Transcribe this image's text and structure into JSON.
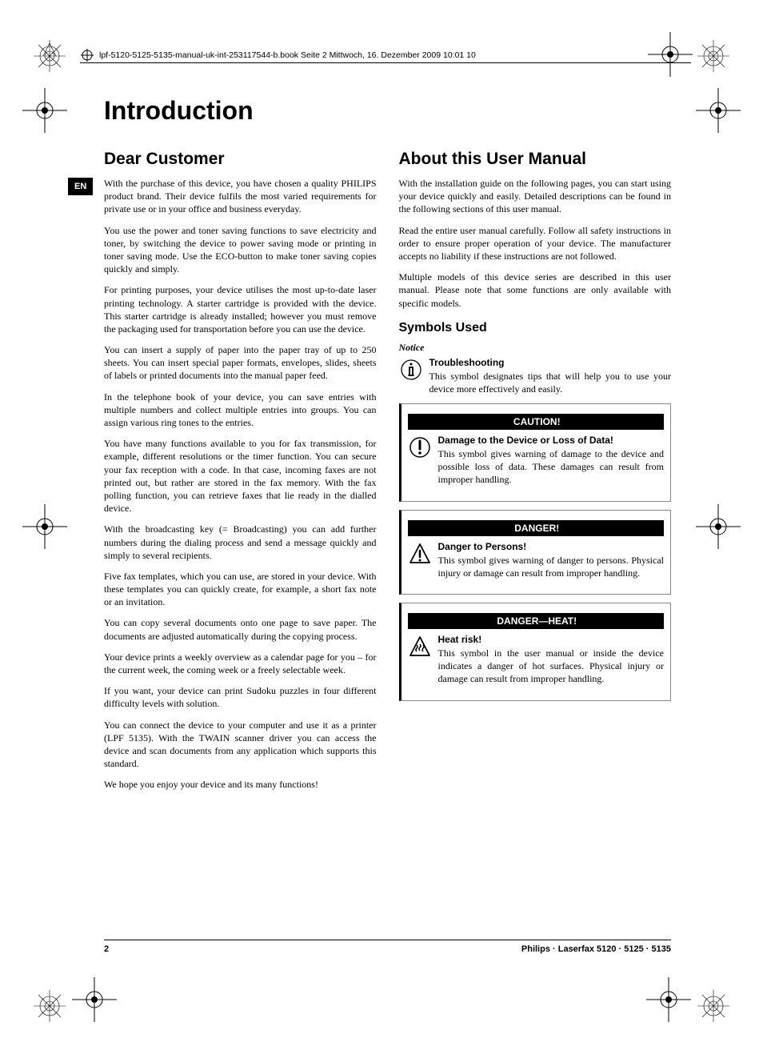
{
  "header": {
    "meta_line": "lpf-5120-5125-5135-manual-uk-int-253117544-b.book  Seite 2  Mittwoch, 16. Dezember 2009  10:01 10"
  },
  "lang_tab": "EN",
  "chapter_title": "Introduction",
  "left_column": {
    "heading": "Dear Customer",
    "paragraphs": [
      "With the purchase of this device, you have chosen a quality PHILIPS product brand. Their device fulfils the most varied requirements for private use or in your office and business everyday.",
      "You use the power and toner saving functions to save electricity and toner, by switching the device to power saving mode or printing in toner saving mode. Use the ECO-button to make toner saving copies quickly and simply.",
      "For printing purposes, your device utilises the most up-to-date laser printing technology. A starter cartridge is provided with the device. This starter cartridge is already installed; however you must remove the packaging used for transportation before you can use the device.",
      "You can insert a supply of paper into the paper tray of up to 250 sheets. You can insert special paper formats, envelopes, slides, sheets of labels or printed documents into the manual paper feed.",
      "In the telephone book of your device, you can save entries with multiple numbers and collect multiple entries into groups. You can assign various ring tones to the entries.",
      "You have many functions available to you for fax transmission, for example, different resolutions or the timer function. You can secure your fax reception with a code. In that case, incoming faxes are not printed out, but rather are stored in the fax memory. With the fax polling function, you can retrieve faxes that lie ready in the dialled device.",
      "With the broadcasting key (= Broadcasting) you can add further numbers during the dialing process and send a message quickly and simply to several recipients.",
      "Five fax templates, which you can use, are stored in your device. With these templates you can quickly create, for example, a short fax note or an invitation.",
      "You can copy several documents onto one page to save paper. The documents are adjusted automatically during the copying process.",
      "Your device prints a weekly overview as a calendar page for you – for the current week, the coming week or a freely selectable week.",
      "If you want, your device can print Sudoku puzzles in four different difficulty levels with solution.",
      "You can connect the device to your computer and use it as a printer (LPF 5135). With the TWAIN scanner driver you can access the device and scan documents from any application which supports this standard.",
      "We hope you enjoy your device and its many functions!"
    ]
  },
  "right_column": {
    "heading": "About this User Manual",
    "intro_paragraphs": [
      "With the installation guide on the following pages, you can start using your device quickly and easily. Detailed descriptions can be found in the following sections of this user manual.",
      "Read the entire user manual carefully. Follow all safety instructions in order to ensure proper operation of your device. The manufacturer accepts no liability if these instructions are not followed.",
      "Multiple models of this device series are described in this user manual. Please note that some functions are only available with specific models."
    ],
    "symbols_heading": "Symbols Used",
    "notice_label": "Notice",
    "notice": {
      "title": "Troubleshooting",
      "body": "This symbol designates tips that will help you to use your device more effectively and easily."
    },
    "caution": {
      "banner": "CAUTION!",
      "title": "Damage to the Device or Loss of Data!",
      "body": "This symbol gives warning of damage to the device and possible loss of data. These damages can result from improper handling."
    },
    "danger": {
      "banner": "DANGER!",
      "title": "Danger to Persons!",
      "body": "This symbol gives warning of danger to persons. Physical injury or damage can result from improper handling."
    },
    "danger_heat": {
      "banner": "DANGER—HEAT!",
      "title": "Heat risk!",
      "body": "This symbol in the user manual or inside the device indicates a danger of hot surfaces. Physical injury or damage can result from improper handling."
    }
  },
  "footer": {
    "page_number": "2",
    "product_line": "Philips · Laserfax 5120 · 5125 · 5135"
  }
}
